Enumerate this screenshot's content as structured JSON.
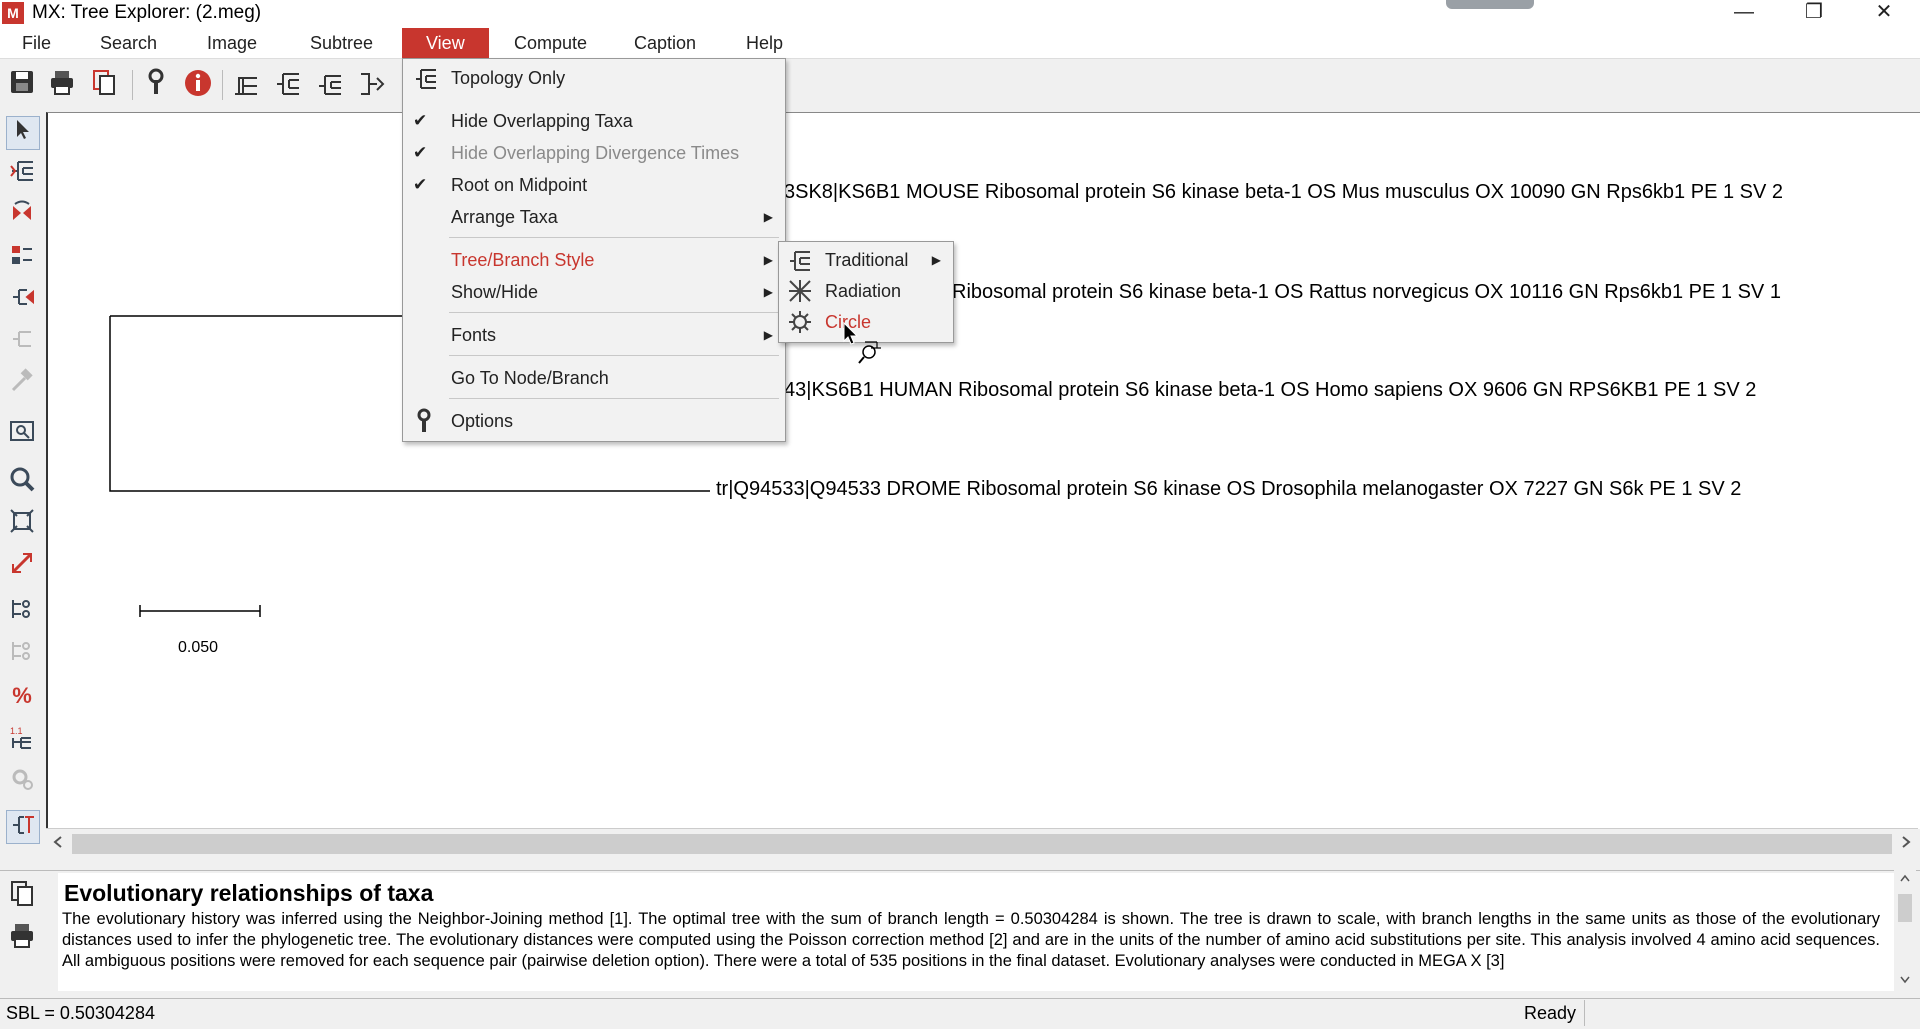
{
  "window": {
    "app_icon": "M",
    "title": "MX: Tree Explorer: (2.meg)",
    "controls": {
      "minimize": "—",
      "restore": "❐",
      "close": "✕"
    }
  },
  "menubar": [
    "File",
    "Search",
    "Image",
    "Subtree",
    "View",
    "Compute",
    "Caption",
    "Help"
  ],
  "toolbar": {
    "icons": [
      "save-icon",
      "print-icon",
      "copy-icon",
      "wrench-icon",
      "info-icon",
      "tree-style-1-icon",
      "tree-style-2-icon",
      "tree-style-3-icon",
      "tree-style-4-icon"
    ]
  },
  "left_tools": [
    "pointer-icon",
    "subtree-icon",
    "flip-icon",
    "swap-icon",
    "compress-icon",
    "disabled-icon",
    "hammer-icon",
    "search-box-icon",
    "zoom-icon",
    "fit-icon",
    "resize-icon",
    "branch-info-icon",
    "branch-info-disabled-icon",
    "percent-icon",
    "scale-icon",
    "settings-disabled-icon",
    "topology-icon"
  ],
  "view_menu": {
    "items": [
      {
        "label": "Topology Only",
        "icon": "tree-icon"
      },
      {
        "label": "Hide Overlapping Taxa",
        "checked": "✔"
      },
      {
        "label": "Hide Overlapping Divergence Times",
        "checked": "✔"
      },
      {
        "label": "Root on Midpoint",
        "checked": "✔"
      },
      {
        "label": "Arrange Taxa",
        "submenu": "▶"
      },
      {
        "label": "Tree/Branch Style",
        "submenu": "▶"
      },
      {
        "label": "Show/Hide",
        "submenu": "▶"
      },
      {
        "label": "Fonts",
        "submenu": "▶"
      },
      {
        "label": "Go To Node/Branch"
      },
      {
        "label": "Options",
        "icon": "wrench-icon"
      }
    ]
  },
  "style_submenu": {
    "items": [
      {
        "label": "Traditional",
        "icon": "traditional-tree-icon",
        "submenu": "▶"
      },
      {
        "label": "Radiation",
        "icon": "radiation-tree-icon"
      },
      {
        "label": "Circle",
        "icon": "circle-tree-icon"
      }
    ]
  },
  "tree": {
    "taxa": [
      "3SK8|KS6B1 MOUSE Ribosomal protein S6 kinase beta-1 OS Mus musculus OX 10090 GN Rps6kb1 PE 1 SV 2",
      "Ribosomal protein S6 kinase beta-1 OS Rattus norvegicus OX 10116 GN Rps6kb1 PE 1 SV 1",
      "43|KS6B1 HUMAN Ribosomal protein S6 kinase beta-1 OS Homo sapiens OX 9606 GN RPS6KB1 PE 1 SV 2",
      "tr|Q94533|Q94533 DROME Ribosomal protein S6 kinase OS Drosophila melanogaster OX 7227 GN S6k PE 1 SV 2"
    ],
    "scale_label": "0.050"
  },
  "caption": {
    "title": "Evolutionary relationships of taxa",
    "body": "The evolutionary history was inferred using the Neighbor-Joining method [1]. The optimal tree with the sum of branch length = 0.50304284 is shown. The tree is drawn to scale, with branch lengths in the same units as those of the evolutionary distances used to infer the phylogenetic tree. The evolutionary distances were computed using the Poisson correction method [2] and are in the units of the number of amino acid substitutions per site. This analysis involved 4 amino acid sequences. All ambiguous positions were removed for each sequence pair (pairwise deletion option). There were a total of 535 positions in the final dataset. Evolutionary analyses were conducted in MEGA X [3]"
  },
  "status": {
    "sbl": "SBL = 0.50304284",
    "ready": "Ready"
  },
  "colors": {
    "accent": "#c8362e",
    "menu_bg": "#f2f2f2"
  }
}
